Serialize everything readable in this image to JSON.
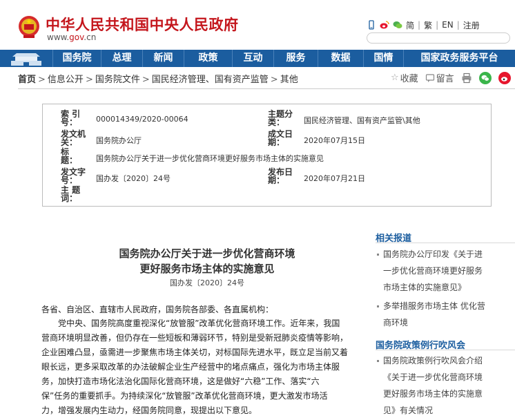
{
  "header": {
    "site_title": "中华人民共和国中央人民政府",
    "site_url_prefix": "www.",
    "site_url_highlight": "gov",
    "site_url_suffix": ".cn",
    "tools": {
      "simplified": "简",
      "traditional": "繁",
      "english": "EN",
      "register": "注册"
    },
    "search": {
      "placeholder": ""
    }
  },
  "nav": {
    "items": [
      "国务院",
      "总理",
      "新闻",
      "政策",
      "互动",
      "服务",
      "数据",
      "国情",
      "国家政务服务平台"
    ]
  },
  "breadcrumb": {
    "items": [
      "首页",
      "信息公开",
      "国务院文件",
      "国民经济管理、国有资产监管",
      "其他"
    ],
    "separator": ">",
    "collect": "收藏",
    "message": "留言"
  },
  "info": {
    "index_label": "索 引 号：",
    "index_value": "000014349/2020-00064",
    "category_label": "主题分类：",
    "category_value": "国民经济管理、国有资产监管\\其他",
    "issuer_label": "发文机关：",
    "issuer_value": "国务院办公厅",
    "created_label": "成文日期：",
    "created_value": "2020年07月15日",
    "title_label": "标 题：",
    "title_value": "国务院办公厅关于进一步优化营商环境更好服务市场主体的实施意见",
    "docno_label": "发文字号：",
    "docno_value": "国办发〔2020〕24号",
    "published_label": "发布日期：",
    "published_value": "2020年07月21日",
    "subject_label": "主 题 词："
  },
  "article": {
    "title_line1": "国务院办公厅关于进一步优化营商环境",
    "title_line2": "更好服务市场主体的实施意见",
    "doc_no": "国办发〔2020〕24号",
    "salutation": "各省、自治区、直辖市人民政府，国务院各部委、各直属机构：",
    "body_lines": [
      "　　党中央、国务院高度重视深化“放管服”改革优化营商环境工作。近年来，我国",
      "营商环境明显改善，但仍存在一些短板和薄弱环节，特别是受新冠肺炎疫情等影响，",
      "企业困难凸显，亟需进一步聚焦市场主体关切，对标国际先进水平，既立足当前又着",
      "眼长远，更多采取改革的办法破解企业生产经营中的堵点痛点，强化为市场主体服",
      "务，加快打造市场化法治化国际化营商环境，这是做好“六稳”工作、落实“六",
      "保”任务的重要抓手。为持续深化“放管服”改革优化营商环境，更大激发市场活",
      "力，增强发展内生动力，经国务院同意，现提出以下意见。"
    ]
  },
  "sidebar": {
    "related_title": "相关报道",
    "related": [
      [
        "国务院办公厅印发《关于进",
        "一步优化营商环境更好服务",
        "市场主体的实施意见》"
      ],
      [
        "多举措服务市场主体 优化营",
        "商环境"
      ]
    ],
    "policy_title": "国务院政策例行吹风会",
    "policy": [
      [
        "国务院政策例行吹风会介绍",
        "《关于进一步优化营商环境",
        "更好服务市场主体的实施意",
        "见》有关情况"
      ]
    ]
  },
  "colors": {
    "brand_red": "#c4161c",
    "nav_blue": "#1b5d9f",
    "link_blue": "#1b5d9f"
  },
  "icons": [
    "national-emblem-icon",
    "mobile-icon",
    "weibo-icon",
    "wechat-icon",
    "star-icon",
    "comment-icon",
    "print-icon"
  ]
}
